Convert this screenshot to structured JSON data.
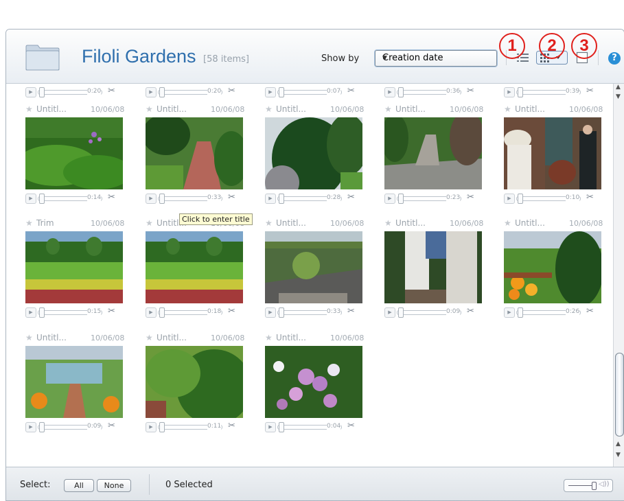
{
  "header": {
    "title": "Filoli Gardens",
    "item_count": "[58 items]",
    "show_by_label": "Show by",
    "show_by_value": "Creation date",
    "annotations": [
      "1",
      "2",
      "3"
    ],
    "help_label": "?"
  },
  "tooltip": "Click to enter title",
  "top_partial_row": [
    {
      "duration": "0:20"
    },
    {
      "duration": "0:20"
    },
    {
      "duration": "0:07"
    },
    {
      "duration": "0:36"
    },
    {
      "duration": "0:39"
    }
  ],
  "clips": [
    {
      "title": "Untitl...",
      "date": "10/06/08",
      "duration": "0:14",
      "scene": "lawn"
    },
    {
      "title": "Untitl...",
      "date": "10/06/08",
      "duration": "0:33",
      "scene": "path"
    },
    {
      "title": "Untitl...",
      "date": "10/06/08",
      "duration": "0:28",
      "scene": "hedge"
    },
    {
      "title": "Untitl...",
      "date": "10/06/08",
      "duration": "0:23",
      "scene": "stone"
    },
    {
      "title": "Untitl...",
      "date": "10/06/08",
      "duration": "0:10",
      "scene": "people"
    },
    {
      "title": "Trim",
      "date": "10/06/08",
      "duration": "0:15",
      "scene": "garden"
    },
    {
      "title": "Untitl...",
      "date": "10/06/08",
      "duration": "0:18",
      "scene": "garden"
    },
    {
      "title": "Untitl...",
      "date": "10/06/08",
      "duration": "0:33",
      "scene": "terrace"
    },
    {
      "title": "Untitl...",
      "date": "10/06/08",
      "duration": "0:09",
      "scene": "legs"
    },
    {
      "title": "Untitl...",
      "date": "10/06/08",
      "duration": "0:26",
      "scene": "flowers"
    },
    {
      "title": "Untitl...",
      "date": "10/06/08",
      "duration": "0:09",
      "scene": "pool"
    },
    {
      "title": "Untitl...",
      "date": "10/06/08",
      "duration": "0:11",
      "scene": "bush"
    },
    {
      "title": "Untitl...",
      "date": "10/06/08",
      "duration": "0:04",
      "scene": "hydrangea"
    }
  ],
  "footer": {
    "select_label": "Select:",
    "all_label": "All",
    "none_label": "None",
    "selected_text": "0 Selected"
  }
}
